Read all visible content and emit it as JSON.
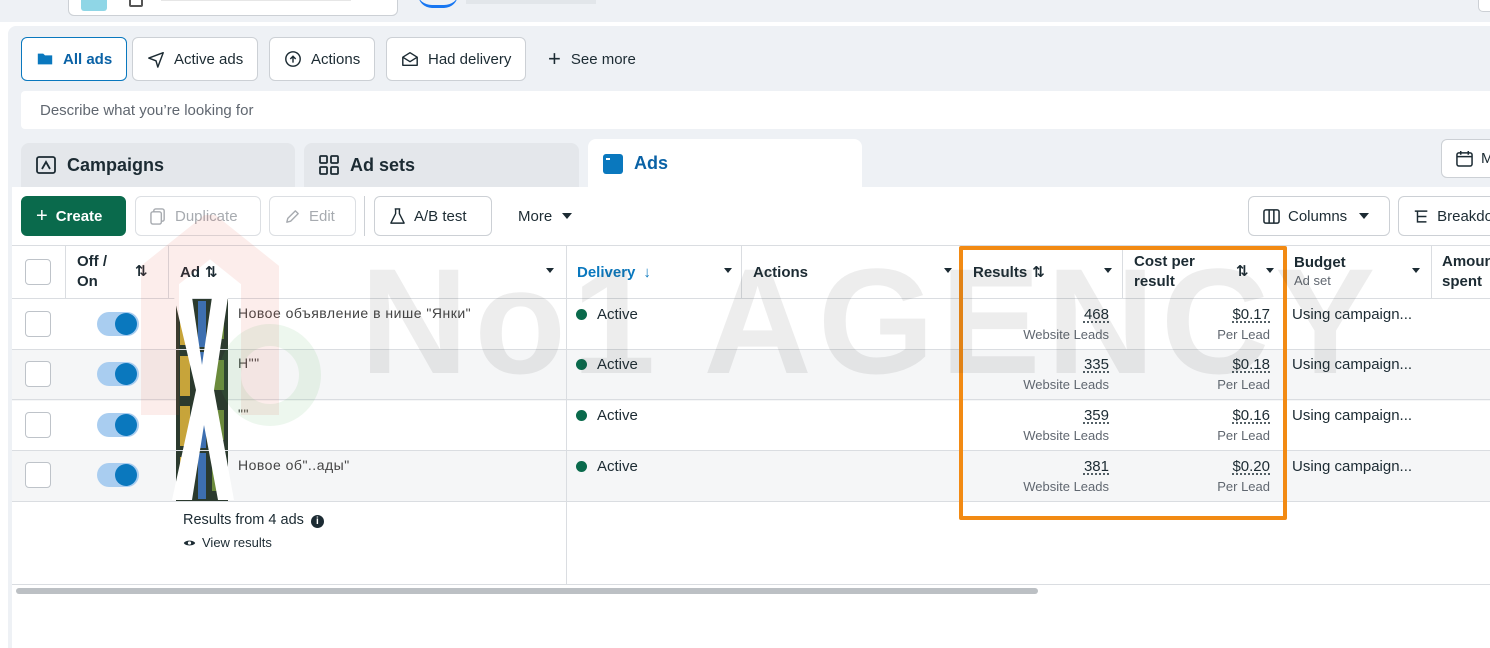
{
  "filters": [
    {
      "label": "All ads",
      "icon": "folder-icon",
      "active": true
    },
    {
      "label": "Active ads",
      "icon": "send-icon",
      "active": false
    },
    {
      "label": "Actions",
      "icon": "arrow-up-circle-icon",
      "active": false
    },
    {
      "label": "Had delivery",
      "icon": "envelope-open-icon",
      "active": false
    }
  ],
  "see_more_label": "See more",
  "search_placeholder": "Describe what you’re looking for",
  "level_tabs": [
    {
      "label": "Campaigns",
      "icon": "campaign-flag-icon"
    },
    {
      "label": "Ad sets",
      "icon": "grid-icon"
    },
    {
      "label": "Ads",
      "icon": "ad-window-icon",
      "selected": true
    }
  ],
  "calendar_label": "M",
  "toolbar": {
    "create": "Create",
    "duplicate": "Duplicate",
    "edit": "Edit",
    "ab_test": "A/B test",
    "more": "More",
    "columns": "Columns",
    "breakdown": "Breakdo"
  },
  "columns": {
    "offon": "Off / On",
    "ad": "Ad",
    "delivery": "Delivery",
    "actions": "Actions",
    "results": "Results",
    "cost": "Cost per result",
    "budget": "Budget",
    "budget_sub": "Ad set",
    "amount": "Amount spent"
  },
  "rows": [
    {
      "ad_name": "Новое объявление в нише \"Янки\"",
      "delivery": "Active",
      "results": "468",
      "results_unit": "Website Leads",
      "cost": "$0.17",
      "cost_unit": "Per Lead",
      "budget": "Using campaign..."
    },
    {
      "ad_name": "Н\"\"",
      "delivery": "Active",
      "results": "335",
      "results_unit": "Website Leads",
      "cost": "$0.18",
      "cost_unit": "Per Lead",
      "budget": "Using campaign..."
    },
    {
      "ad_name": "\"\"",
      "delivery": "Active",
      "results": "359",
      "results_unit": "Website Leads",
      "cost": "$0.16",
      "cost_unit": "Per Lead",
      "budget": "Using campaign..."
    },
    {
      "ad_name": "Новое об\"..ады\"",
      "delivery": "Active",
      "results": "381",
      "results_unit": "Website Leads",
      "cost": "$0.20",
      "cost_unit": "Per Lead",
      "budget": "Using campaign..."
    }
  ],
  "footer": {
    "results_text": "Results from 4 ads",
    "view_results": "View results"
  },
  "watermark": "No1 AGENCY",
  "colors": {
    "primary_blue": "#0a78be",
    "create_green": "#0a6a4c",
    "highlight_orange": "#f28a13"
  }
}
